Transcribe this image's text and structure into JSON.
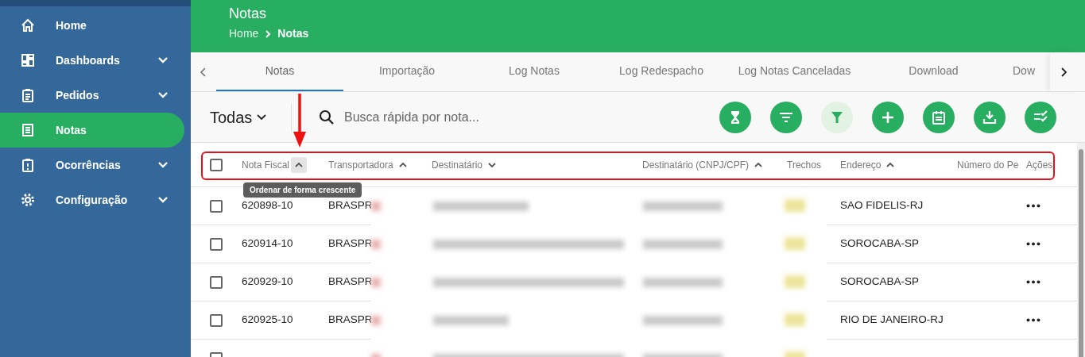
{
  "sidebar": {
    "items": [
      {
        "label": "Home",
        "has_submenu": false,
        "selected": false
      },
      {
        "label": "Dashboards",
        "has_submenu": true,
        "selected": false
      },
      {
        "label": "Pedidos",
        "has_submenu": true,
        "selected": false
      },
      {
        "label": "Notas",
        "has_submenu": false,
        "selected": true
      },
      {
        "label": "Ocorrências",
        "has_submenu": true,
        "selected": false
      },
      {
        "label": "Configuração",
        "has_submenu": true,
        "selected": false
      }
    ]
  },
  "header": {
    "title": "Notas",
    "breadcrumb": [
      {
        "label": "Home",
        "current": false
      },
      {
        "label": "Notas",
        "current": true
      }
    ]
  },
  "tabs": [
    {
      "label": "Notas",
      "selected": true
    },
    {
      "label": "Importação",
      "selected": false
    },
    {
      "label": "Log Notas",
      "selected": false
    },
    {
      "label": "Log Redespacho",
      "selected": false
    },
    {
      "label": "Log Notas Canceladas",
      "selected": false
    },
    {
      "label": "Download",
      "selected": false
    },
    {
      "label": "Dow",
      "selected": false
    }
  ],
  "toolbar": {
    "filter_dropdown": "Todas",
    "search": {
      "placeholder": "Busca rápida por nota..."
    },
    "actions": [
      {
        "kind": "hourglass",
        "active": false
      },
      {
        "kind": "sort-lines",
        "active": false
      },
      {
        "kind": "funnel",
        "active": true
      },
      {
        "kind": "plus",
        "active": false
      },
      {
        "kind": "notepad",
        "active": false
      },
      {
        "kind": "download",
        "active": false
      },
      {
        "kind": "checklist",
        "active": false
      }
    ]
  },
  "table": {
    "select_all_checked": false,
    "columns": [
      {
        "label": "Nota Fiscal",
        "sortable": true,
        "sort_ascending": true,
        "hovered": true
      },
      {
        "label": "Transportadora",
        "sortable": true,
        "sort_ascending": true,
        "hovered": false
      },
      {
        "label": "Destinatário",
        "sortable": true,
        "sort_ascending": false,
        "hovered": false
      },
      {
        "label": "Destinatário (CNPJ/CPF)",
        "sortable": true,
        "sort_ascending": true,
        "hovered": false
      },
      {
        "label": "Trechos",
        "sortable": false,
        "hovered": false
      },
      {
        "label": "Endereço",
        "sortable": true,
        "sort_ascending": true,
        "hovered": false
      },
      {
        "label": "Número do Pe",
        "sortable": false,
        "hovered": false
      },
      {
        "label": "Ações",
        "sortable": false,
        "hovered": false
      }
    ],
    "tooltip": "Ordenar de forma crescente",
    "rows": [
      {
        "checked": false,
        "nota_fiscal": "620898-10",
        "transportadora": "BRASPR",
        "endereco": "SAO FIDELIS-RJ"
      },
      {
        "checked": false,
        "nota_fiscal": "620914-10",
        "transportadora": "BRASPR",
        "endereco": "SOROCABA-SP"
      },
      {
        "checked": false,
        "nota_fiscal": "620929-10",
        "transportadora": "BRASPR",
        "endereco": "SOROCABA-SP"
      },
      {
        "checked": false,
        "nota_fiscal": "620925-10",
        "transportadora": "BRASPR",
        "endereco": "RIO DE JANEIRO-RJ"
      },
      {
        "checked": false
      }
    ]
  }
}
